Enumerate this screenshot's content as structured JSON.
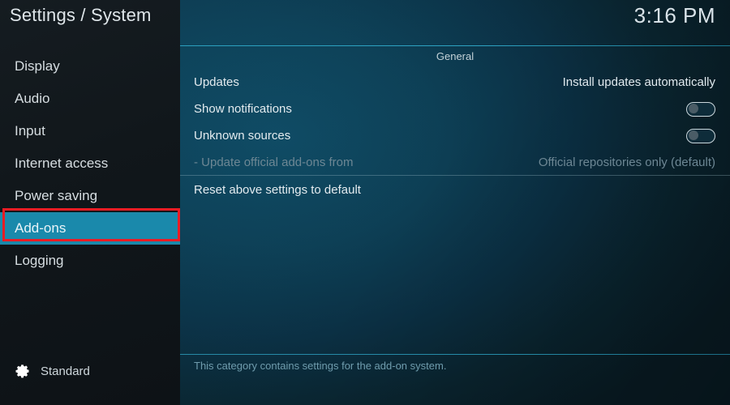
{
  "window": {
    "title": "Settings / System",
    "clock": "3:16 PM"
  },
  "colors": {
    "selection_teal": "#1a89ab",
    "annotation_red": "#ec1c24",
    "rule_teal": "#2da4c4",
    "sidebar_bg": "#12181c",
    "panel_bg": "#0d4258",
    "text_primary": "#e3ebef",
    "text_disabled": "#6d8794",
    "help_text": "#6f9cad"
  },
  "sidebar": {
    "items": [
      {
        "label": "Display",
        "selected": false,
        "annotated": false
      },
      {
        "label": "Audio",
        "selected": false,
        "annotated": false
      },
      {
        "label": "Input",
        "selected": false,
        "annotated": false
      },
      {
        "label": "Internet access",
        "selected": false,
        "annotated": false
      },
      {
        "label": "Power saving",
        "selected": false,
        "annotated": false
      },
      {
        "label": "Add-ons",
        "selected": true,
        "annotated": true
      },
      {
        "label": "Logging",
        "selected": false,
        "annotated": false
      }
    ],
    "profile": {
      "icon": "gear-icon",
      "label": "Standard"
    }
  },
  "main": {
    "section_header": "General",
    "rows": [
      {
        "label": "Updates",
        "type": "value",
        "value": "Install updates automatically",
        "disabled": false
      },
      {
        "label": "Show notifications",
        "type": "toggle",
        "value": "off",
        "disabled": false
      },
      {
        "label": "Unknown sources",
        "type": "toggle",
        "value": "off",
        "disabled": false
      },
      {
        "label": "- Update official add-ons from",
        "type": "value",
        "value": "Official repositories only (default)",
        "disabled": true
      }
    ],
    "reset_row": {
      "label": "Reset above settings to default"
    },
    "help_text": "This category contains settings for the add-on system."
  }
}
